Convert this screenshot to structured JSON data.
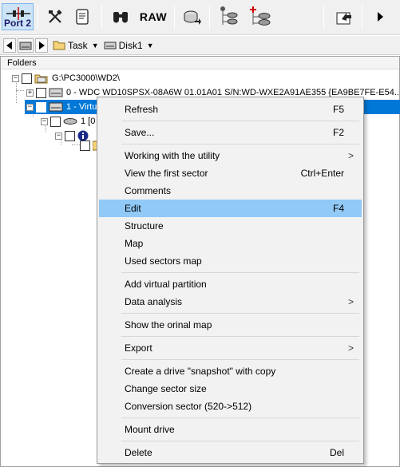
{
  "toolbar": {
    "port_label": "Port 2",
    "raw_label": "RAW"
  },
  "pathbar": {
    "task_label": "Task",
    "disk_label": "Disk1"
  },
  "folders_header": "Folders",
  "tree": {
    "root": "G:\\PC3000\\WD2\\",
    "drive0": "0 - WDC WD10SPSX-08A6W 01.01A01 S/N:WD-WXE2A91AE355 {EA9BE7FE-E54...",
    "drive1": "1 - Virtua",
    "part": "1 [0"
  },
  "menu": {
    "refresh": {
      "label": "Refresh",
      "shortcut": "F5"
    },
    "save": {
      "label": "Save...",
      "shortcut": "F2"
    },
    "working": {
      "label": "Working with the utility"
    },
    "view_first": {
      "label": "View the first sector",
      "shortcut": "Ctrl+Enter"
    },
    "comments": {
      "label": "Comments"
    },
    "edit": {
      "label": "Edit",
      "shortcut": "F4"
    },
    "structure": {
      "label": "Structure"
    },
    "map": {
      "label": "Map"
    },
    "used_map": {
      "label": "Used sectors map"
    },
    "add_virtual": {
      "label": "Add virtual partition"
    },
    "data_analysis": {
      "label": "Data analysis"
    },
    "orinal_map": {
      "label": "Show the orinal map"
    },
    "export": {
      "label": "Export"
    },
    "snapshot": {
      "label": "Create a drive \"snapshot\" with copy"
    },
    "change_size": {
      "label": "Change sector size"
    },
    "conversion": {
      "label": "Conversion sector (520->512)"
    },
    "mount": {
      "label": "Mount drive"
    },
    "delete": {
      "label": "Delete",
      "shortcut": "Del"
    },
    "submenu_arrow": ">"
  },
  "colors": {
    "selection": "#0078d7",
    "menu_highlight": "#91c9f7",
    "port_active_bg": "#cce4f7"
  }
}
